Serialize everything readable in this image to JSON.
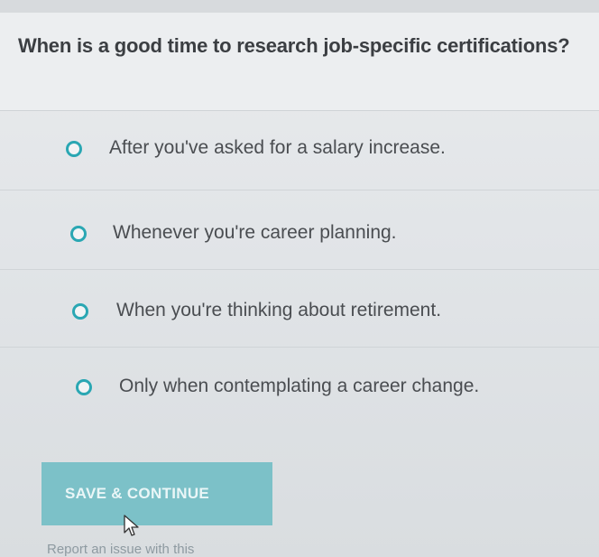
{
  "question": {
    "text": "When is a good time to research job-specific certifications?"
  },
  "answers": [
    {
      "label": "After you've asked for a salary increase."
    },
    {
      "label": "Whenever you're career planning."
    },
    {
      "label": "When you're thinking about retirement."
    },
    {
      "label": "Only when contemplating a career change."
    }
  ],
  "actions": {
    "save_label": "SAVE & CONTINUE",
    "report_label": "Report an issue with this"
  },
  "colors": {
    "accent": "#2aa7b3",
    "button": "#7cc1c8"
  },
  "icons": {
    "radio": "radio-unselected-icon",
    "cursor": "mouse-pointer-icon"
  }
}
